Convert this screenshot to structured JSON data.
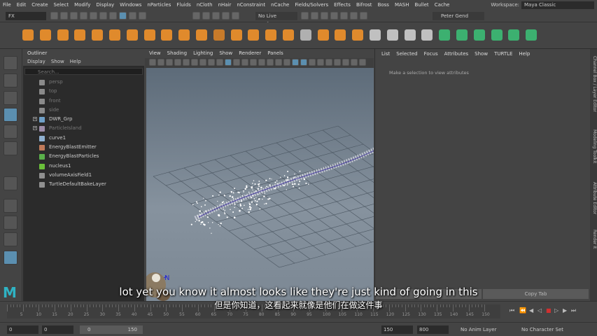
{
  "menubar": {
    "items": [
      "File",
      "Edit",
      "Create",
      "Select",
      "Modify",
      "Display",
      "Windows",
      "nParticles",
      "Fluids",
      "nCloth",
      "nHair",
      "nConstraint",
      "nCache",
      "Fields/Solvers",
      "Effects",
      "Bifrost",
      "Boss",
      "MASH",
      "Bullet",
      "Cache"
    ],
    "workspace_label": "Workspace:",
    "workspace_value": "Maya Classic"
  },
  "statusline": {
    "menuset": "FX",
    "live_surface": "No Live Surface",
    "user": "Peter Gend"
  },
  "outliner": {
    "title": "Outliner",
    "menu": [
      "Display",
      "Show",
      "Help"
    ],
    "search_placeholder": "Search...",
    "items": [
      {
        "label": "persp",
        "dim": true,
        "color": "#8a8a8a"
      },
      {
        "label": "top",
        "dim": true,
        "color": "#8a8a8a"
      },
      {
        "label": "front",
        "dim": true,
        "color": "#8a8a8a"
      },
      {
        "label": "side",
        "dim": true,
        "color": "#8a8a8a"
      },
      {
        "label": "DWR_Grp",
        "dim": false,
        "color": "#6fa0c8",
        "expand": "+"
      },
      {
        "label": "ParticleIsland",
        "dim": true,
        "color": "#9c8ca8",
        "expand": "+"
      },
      {
        "label": "curve1",
        "dim": false,
        "color": "#8fb0d0"
      },
      {
        "label": "EnergyBlastEmitter",
        "dim": false,
        "color": "#c07a5a"
      },
      {
        "label": "EnergyBlastParticles",
        "dim": false,
        "color": "#5ab04a"
      },
      {
        "label": "nucleus1",
        "dim": false,
        "color": "#6ac03a"
      },
      {
        "label": "volumeAxisField1",
        "dim": false,
        "color": "#909090"
      },
      {
        "label": "TurtleDefaultBakeLayer",
        "dim": false,
        "color": "#909090"
      }
    ]
  },
  "viewport": {
    "menu": [
      "View",
      "Shading",
      "Lighting",
      "Show",
      "Renderer",
      "Panels"
    ],
    "axis_label": "N"
  },
  "attribute_editor": {
    "menu": [
      "List",
      "Selected",
      "Focus",
      "Attributes",
      "Show",
      "TURTLE",
      "Help"
    ],
    "message": "Make a selection to view attributes",
    "buttons": [
      "",
      "Copy Tab"
    ]
  },
  "side_tabs": [
    "Channel Box / Layer Editor",
    "Modeling Toolkit",
    "Attribute Editor",
    "Render It"
  ],
  "timeline": {
    "ticks": [
      "5",
      "10",
      "15",
      "20",
      "25",
      "30",
      "35",
      "40",
      "45",
      "50",
      "55",
      "60",
      "65",
      "70",
      "75",
      "80",
      "85",
      "90",
      "95",
      "100",
      "105",
      "110",
      "115",
      "120",
      "125",
      "130",
      "135",
      "140",
      "145",
      "150"
    ]
  },
  "range": {
    "start": "0",
    "anim_start": "0",
    "range_start": "0",
    "range_end": "150",
    "anim_end": "150",
    "end": "800",
    "anim_layer": "No Anim Layer",
    "char_set": "No Character Set"
  },
  "subtitles": {
    "en": "lot yet you know it almost looks like they're just kind of going in this",
    "zh": "但是你知道，这看起来就像是他们在做这件事"
  },
  "logo": "M"
}
